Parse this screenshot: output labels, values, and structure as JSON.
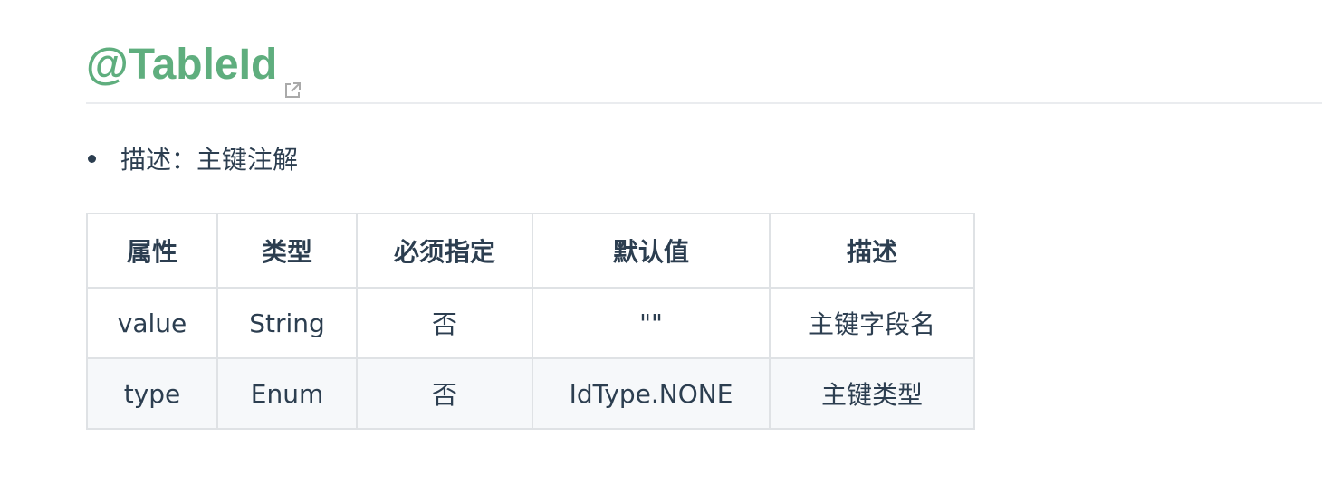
{
  "heading": {
    "title": "@TableId",
    "link_icon": "external-link-icon"
  },
  "description": {
    "items": [
      {
        "text": "描述：主键注解"
      }
    ]
  },
  "table": {
    "headers": [
      "属性",
      "类型",
      "必须指定",
      "默认值",
      "描述"
    ],
    "rows": [
      [
        "value",
        "String",
        "否",
        "\"\"",
        "主键字段名"
      ],
      [
        "type",
        "Enum",
        "否",
        "IdType.NONE",
        "主键类型"
      ]
    ]
  },
  "colors": {
    "heading": "#5fae7e",
    "text": "#2c3e50",
    "border": "#dfe2e5",
    "stripe": "#f6f8fa"
  }
}
